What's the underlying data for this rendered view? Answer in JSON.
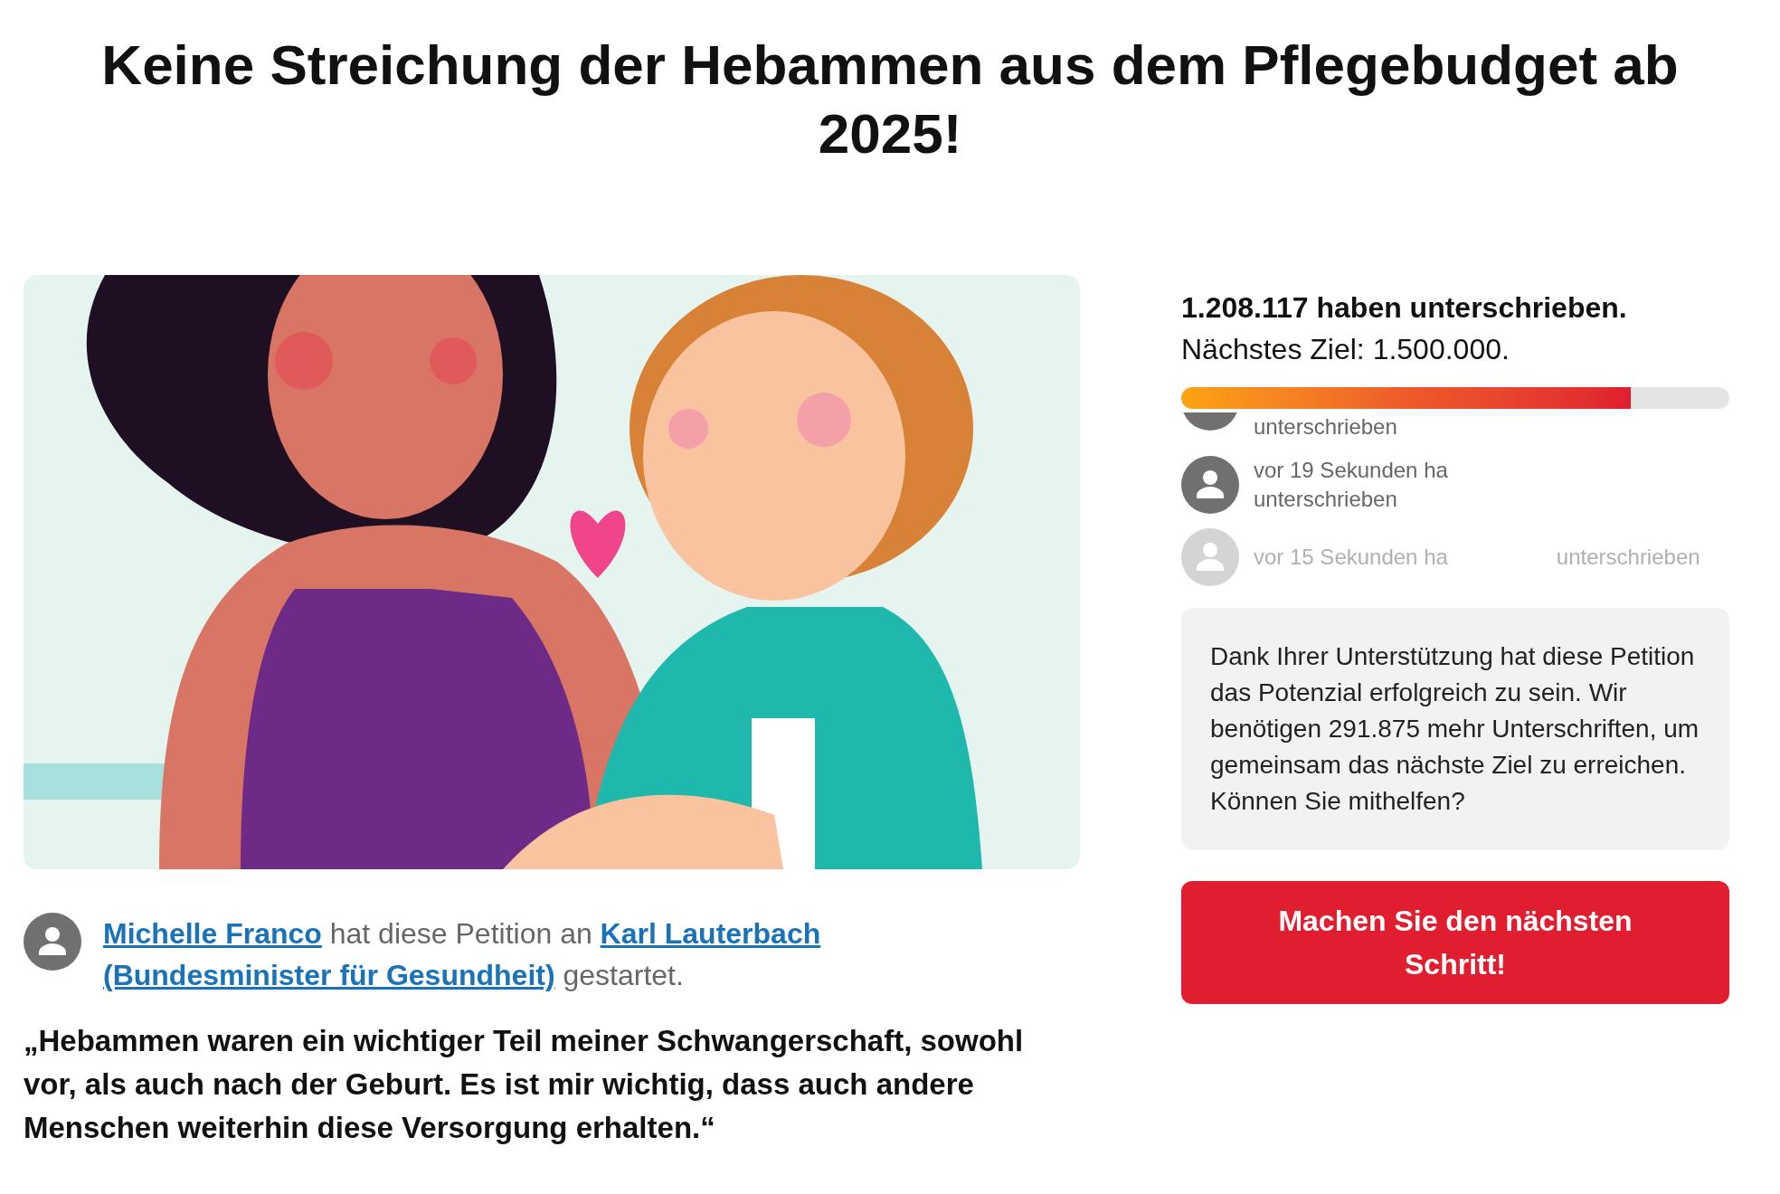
{
  "title": "Keine Streichung der Hebammen aus dem Pflegebudget ab 2025!",
  "signatures": {
    "count_text": "1.208.117 haben unterschrieben.",
    "goal_text": "Nächstes Ziel: 1.500.000.",
    "level": 0.82
  },
  "feed": [
    {
      "lines": [
        "unterschrieben"
      ],
      "faded": false,
      "cut": true
    },
    {
      "lines": [
        "vor 19 Sekunden ha",
        "unterschrieben"
      ],
      "faded": false,
      "cut": false
    },
    {
      "lines": [
        "vor 15 Sekunden ha",
        "unterschrieben"
      ],
      "faded": true,
      "cut": false
    }
  ],
  "support_text": "Dank Ihrer Unterstützung hat diese Petition das Potenzial erfolgreich zu sein. Wir benötigen 291.875 mehr Unterschriften, um gemeinsam das nächste Ziel zu erreichen. Können Sie mithelfen?",
  "cta_button": "Machen Sie den nächsten Schritt!",
  "starter": {
    "author": "Michelle Franco",
    "middle": "hat diese Petition an",
    "recipient_lines": [
      "Karl Lauterbach",
      "(Bundesminister für Gesundheit)"
    ],
    "end": "gestartet."
  },
  "quote": "„Hebammen waren ein wichtiger Teil meiner Schwangerschaft, sowohl vor, als auch nach der Geburt. Es ist mir wichtig, dass auch andere Menschen weiterhin diese Versorgung erhalten.“"
}
